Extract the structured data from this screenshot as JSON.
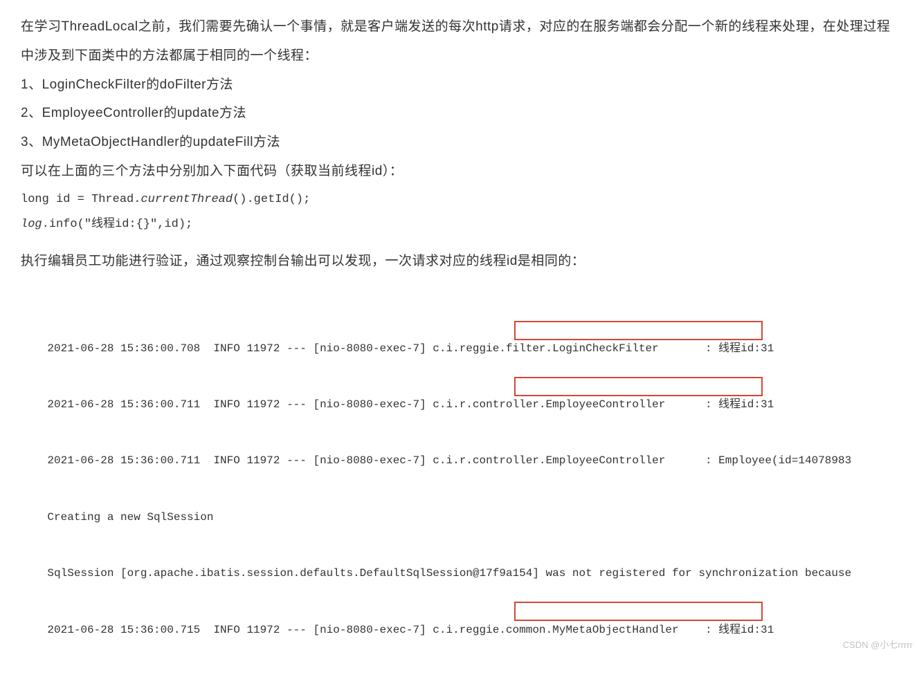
{
  "paragraphs": {
    "p1": "在学习ThreadLocal之前，我们需要先确认一个事情，就是客户端发送的每次http请求，对应的在服务端都会分配一个新的线程来处理，在处理过程中涉及到下面类中的方法都属于相同的一个线程：",
    "l1": "1、LoginCheckFilter的doFilter方法",
    "l2": "2、EmployeeController的update方法",
    "l3": "3、MyMetaObjectHandler的updateFill方法",
    "p2": "可以在上面的三个方法中分别加入下面代码（获取当前线程id）：",
    "p3": "执行编辑员工功能进行验证，通过观察控制台输出可以发现，一次请求对应的线程id是相同的："
  },
  "code": {
    "c1a": "long id = Thread.",
    "c1b": "currentThread",
    "c1c": "().getId();",
    "c2a": "log",
    "c2b": ".info(\"线程id:{}\",id);"
  },
  "logs": {
    "r1": "2021-06-28 15:36:00.708  INFO 11972 --- [nio-8080-exec-7] c.i.reggie.filter.LoginCheckFilter       : 线程id:31",
    "r2": "2021-06-28 15:36:00.711  INFO 11972 --- [nio-8080-exec-7] c.i.r.controller.EmployeeController      : 线程id:31",
    "r3": "2021-06-28 15:36:00.711  INFO 11972 --- [nio-8080-exec-7] c.i.r.controller.EmployeeController      : Employee(id=14078983",
    "r4": "Creating a new SqlSession",
    "r5": "SqlSession [org.apache.ibatis.session.defaults.DefaultSqlSession@17f9a154] was not registered for synchronization because",
    "r6": "2021-06-28 15:36:00.715  INFO 11972 --- [nio-8080-exec-7] c.i.reggie.common.MyMetaObjectHandler    : 线程id:31"
  },
  "watermark": "CSDN @小七rrrrr"
}
